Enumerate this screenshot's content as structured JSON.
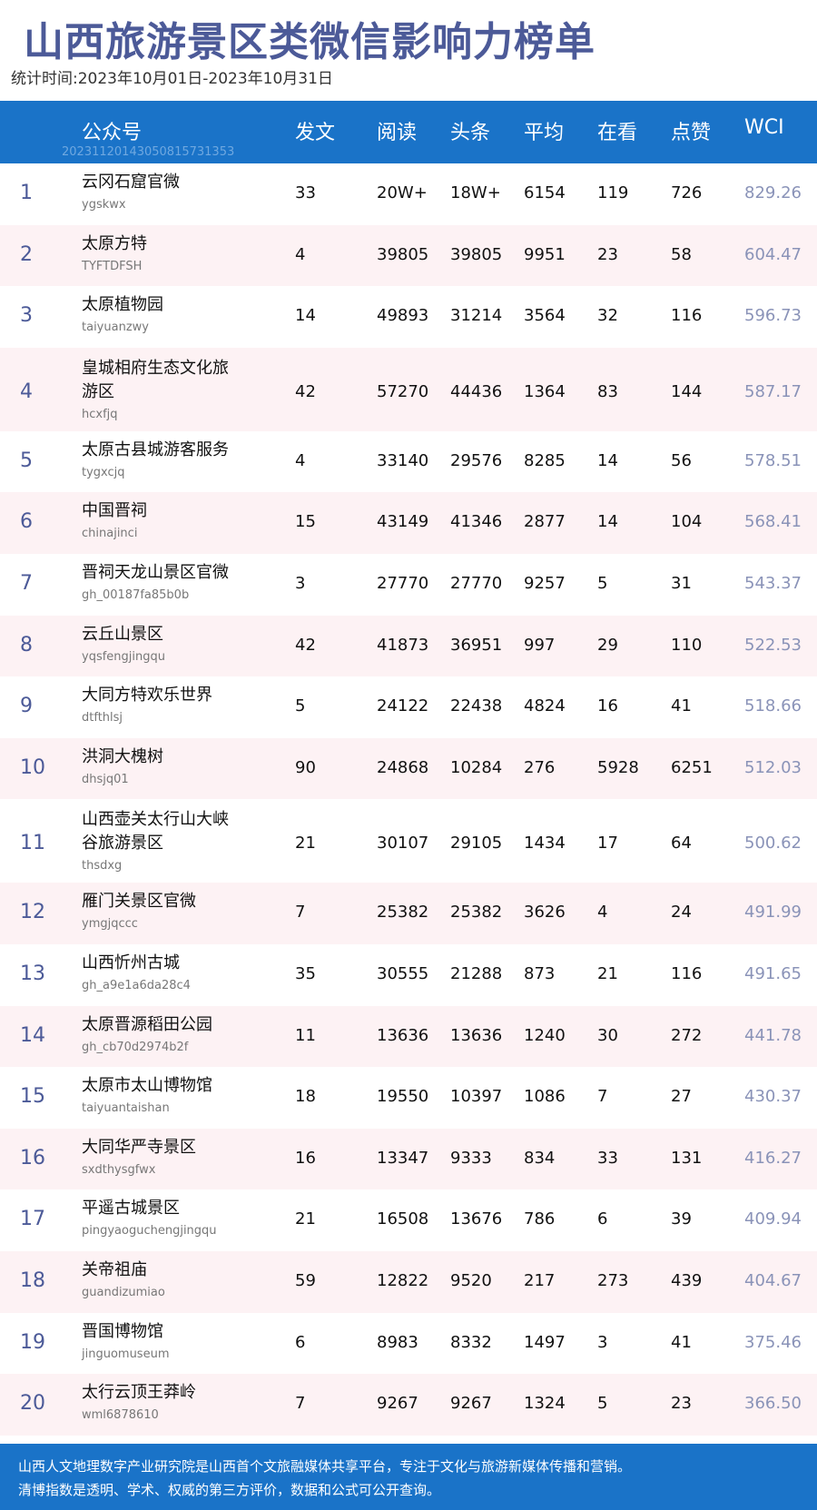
{
  "title": "山西旅游景区类微信影响力榜单",
  "period": "统计时间:2023年10月01日-2023年10月31日",
  "header": {
    "account": "公众号",
    "posts": "发文",
    "reads": "阅读",
    "headline": "头条",
    "average": "平均",
    "watching": "在看",
    "likes": "点赞",
    "wci": "WCI",
    "id": "20231120143050815731353"
  },
  "rows": [
    {
      "rank": "1",
      "name": "云冈石窟官微",
      "account": "ygskwx",
      "posts": "33",
      "reads": "20W+",
      "headline": "18W+",
      "average": "6154",
      "watching": "119",
      "likes": "726",
      "wci": "829.26"
    },
    {
      "rank": "2",
      "name": "太原方特",
      "account": "TYFTDFSH",
      "posts": "4",
      "reads": "39805",
      "headline": "39805",
      "average": "9951",
      "watching": "23",
      "likes": "58",
      "wci": "604.47"
    },
    {
      "rank": "3",
      "name": "太原植物园",
      "account": "taiyuanzwy",
      "posts": "14",
      "reads": "49893",
      "headline": "31214",
      "average": "3564",
      "watching": "32",
      "likes": "116",
      "wci": "596.73"
    },
    {
      "rank": "4",
      "name": "皇城相府生态文化旅游区",
      "account": "hcxfjq",
      "posts": "42",
      "reads": "57270",
      "headline": "44436",
      "average": "1364",
      "watching": "83",
      "likes": "144",
      "wci": "587.17"
    },
    {
      "rank": "5",
      "name": "太原古县城游客服务",
      "account": "tygxcjq",
      "posts": "4",
      "reads": "33140",
      "headline": "29576",
      "average": "8285",
      "watching": "14",
      "likes": "56",
      "wci": "578.51"
    },
    {
      "rank": "6",
      "name": "中国晋祠",
      "account": "chinajinci",
      "posts": "15",
      "reads": "43149",
      "headline": "41346",
      "average": "2877",
      "watching": "14",
      "likes": "104",
      "wci": "568.41"
    },
    {
      "rank": "7",
      "name": "晋祠天龙山景区官微",
      "account": "gh_00187fa85b0b",
      "posts": "3",
      "reads": "27770",
      "headline": "27770",
      "average": "9257",
      "watching": "5",
      "likes": "31",
      "wci": "543.37"
    },
    {
      "rank": "8",
      "name": "云丘山景区",
      "account": "yqsfengjingqu",
      "posts": "42",
      "reads": "41873",
      "headline": "36951",
      "average": "997",
      "watching": "29",
      "likes": "110",
      "wci": "522.53"
    },
    {
      "rank": "9",
      "name": "大同方特欢乐世界",
      "account": "dtfthlsj",
      "posts": "5",
      "reads": "24122",
      "headline": "22438",
      "average": "4824",
      "watching": "16",
      "likes": "41",
      "wci": "518.66"
    },
    {
      "rank": "10",
      "name": "洪洞大槐树",
      "account": "dhsjq01",
      "posts": "90",
      "reads": "24868",
      "headline": "10284",
      "average": "276",
      "watching": "5928",
      "likes": "6251",
      "wci": "512.03"
    },
    {
      "rank": "11",
      "name": "山西壶关太行山大峡谷旅游景区",
      "account": "thsdxg",
      "posts": "21",
      "reads": "30107",
      "headline": "29105",
      "average": "1434",
      "watching": "17",
      "likes": "64",
      "wci": "500.62"
    },
    {
      "rank": "12",
      "name": "雁门关景区官微",
      "account": "ymgjqccc",
      "posts": "7",
      "reads": "25382",
      "headline": "25382",
      "average": "3626",
      "watching": "4",
      "likes": "24",
      "wci": "491.99"
    },
    {
      "rank": "13",
      "name": "山西忻州古城",
      "account": "gh_a9e1a6da28c4",
      "posts": "35",
      "reads": "30555",
      "headline": "21288",
      "average": "873",
      "watching": "21",
      "likes": "116",
      "wci": "491.65"
    },
    {
      "rank": "14",
      "name": "太原晋源稻田公园",
      "account": "gh_cb70d2974b2f",
      "posts": "11",
      "reads": "13636",
      "headline": "13636",
      "average": "1240",
      "watching": "30",
      "likes": "272",
      "wci": "441.78"
    },
    {
      "rank": "15",
      "name": "太原市太山博物馆",
      "account": "taiyuantaishan",
      "posts": "18",
      "reads": "19550",
      "headline": "10397",
      "average": "1086",
      "watching": "7",
      "likes": "27",
      "wci": "430.37"
    },
    {
      "rank": "16",
      "name": "大同华严寺景区",
      "account": "sxdthysgfwx",
      "posts": "16",
      "reads": "13347",
      "headline": "9333",
      "average": "834",
      "watching": "33",
      "likes": "131",
      "wci": "416.27"
    },
    {
      "rank": "17",
      "name": "平遥古城景区",
      "account": "pingyaoguchengjingqu",
      "posts": "21",
      "reads": "16508",
      "headline": "13676",
      "average": "786",
      "watching": "6",
      "likes": "39",
      "wci": "409.94"
    },
    {
      "rank": "18",
      "name": "关帝祖庙",
      "account": "guandizumiao",
      "posts": "59",
      "reads": "12822",
      "headline": "9520",
      "average": "217",
      "watching": "273",
      "likes": "439",
      "wci": "404.67"
    },
    {
      "rank": "19",
      "name": "晋国博物馆",
      "account": "jinguomuseum",
      "posts": "6",
      "reads": "8983",
      "headline": "8332",
      "average": "1497",
      "watching": "3",
      "likes": "41",
      "wci": "375.46"
    },
    {
      "rank": "20",
      "name": "太行云顶王莽岭",
      "account": "wml6878610",
      "posts": "7",
      "reads": "9267",
      "headline": "9267",
      "average": "1324",
      "watching": "5",
      "likes": "23",
      "wci": "366.50"
    }
  ],
  "footer": {
    "line1": "山西人文地理数字产业研究院是山西首个文旅融媒体共享平台，专注于文化与旅游新媒体传播和营销。",
    "line2": "清博指数是透明、学术、权威的第三方评价，数据和公式可公开查询。"
  },
  "colors": {
    "title": "#4c5a98",
    "header_bg": "#1a73c8",
    "row_alt_bg": "#fdf2f4",
    "wci_text": "#8a93b8"
  }
}
